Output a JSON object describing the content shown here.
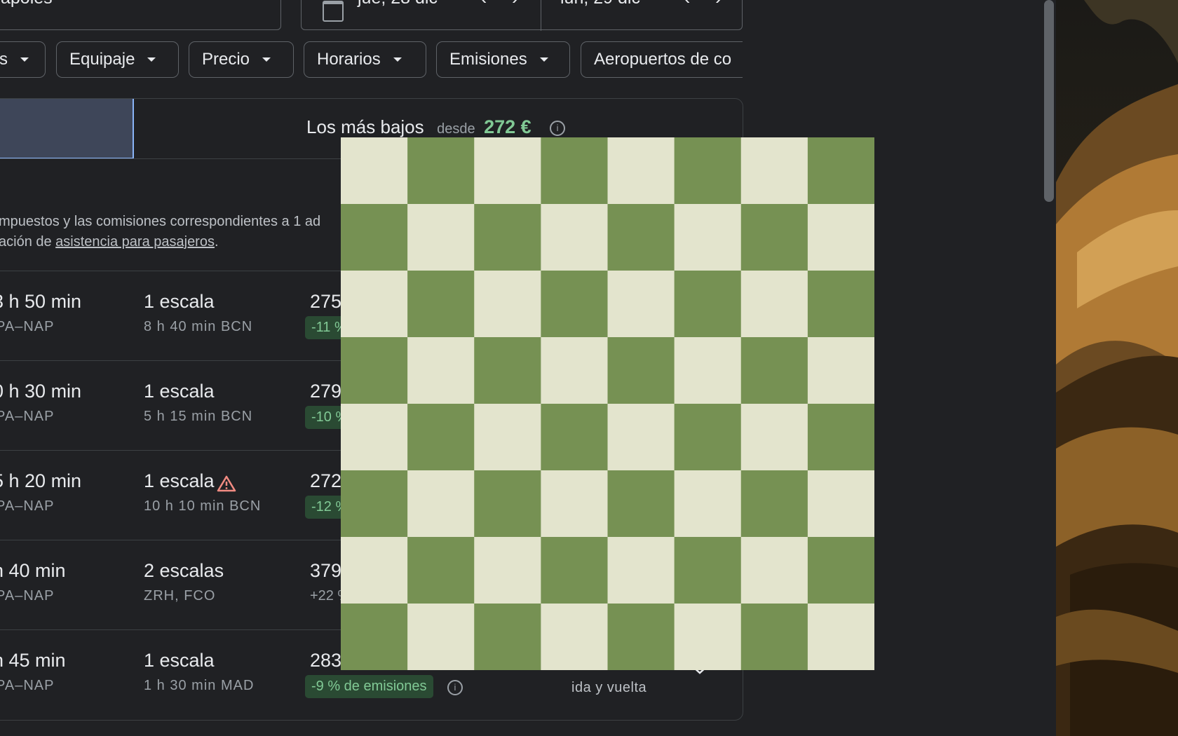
{
  "search": {
    "destination_value": "apoles",
    "depart_date": "jue, 28 dic",
    "return_date": "lun, 29 dic"
  },
  "filters": [
    {
      "label": "s"
    },
    {
      "label": "Equipaje"
    },
    {
      "label": "Precio"
    },
    {
      "label": "Horarios"
    },
    {
      "label": "Emisiones"
    },
    {
      "label": "Aeropuertos de co"
    }
  ],
  "tabs": {
    "cheapest_label": "Los más bajos",
    "from_label": "desde",
    "cheapest_price": "272 €"
  },
  "notice": {
    "line1": "mpuestos y las comisiones correspondientes a 1 ad",
    "line2_prefix": "ación de ",
    "line2_link": "asistencia para pasajeros",
    "line2_suffix": "."
  },
  "flights": [
    {
      "duration": "3 h 50 min",
      "route": "PA–NAP",
      "stops": "1 escala",
      "stop_detail": "8 h 40 min BCN",
      "price": "275",
      "emissions": "-11 %",
      "warning": false
    },
    {
      "duration": "0 h 30 min",
      "route": "PA–NAP",
      "stops": "1 escala",
      "stop_detail": "5 h 15 min BCN",
      "price": "279",
      "emissions": "-10 %",
      "warning": false
    },
    {
      "duration": "5 h 20 min",
      "route": "PA–NAP",
      "stops": "1 escala",
      "stop_detail": "10 h 10 min BCN",
      "price": "272",
      "emissions": "-12 %",
      "warning": true
    },
    {
      "duration": "h 40 min",
      "route": "PA–NAP",
      "stops": "2 escalas",
      "stop_detail": "ZRH, FCO",
      "price": "379",
      "emissions": "+22 %",
      "warning": false
    },
    {
      "duration": "h 45 min",
      "route": "PA–NAP",
      "stops": "1 escala",
      "stop_detail": "1 h 30 min MAD",
      "price": "283",
      "emissions": "-9 % de emisiones",
      "warning": false,
      "trip_type": "ida y vuelta"
    }
  ],
  "colors": {
    "background": "#202124",
    "border": "#3c4043",
    "accent_blue": "#8ab4f8",
    "price_green": "#81c995",
    "emission_badge_bg": "#2a4a33",
    "warning": "#f28b82",
    "checker_dark": "#769153",
    "checker_light": "#e3e4cd"
  },
  "icons": {
    "calendar": "calendar-icon",
    "prev": "chevron-left-icon",
    "next": "chevron-right-icon",
    "info": "info-icon",
    "warning": "warning-triangle-icon",
    "expand": "chevron-down-icon"
  }
}
